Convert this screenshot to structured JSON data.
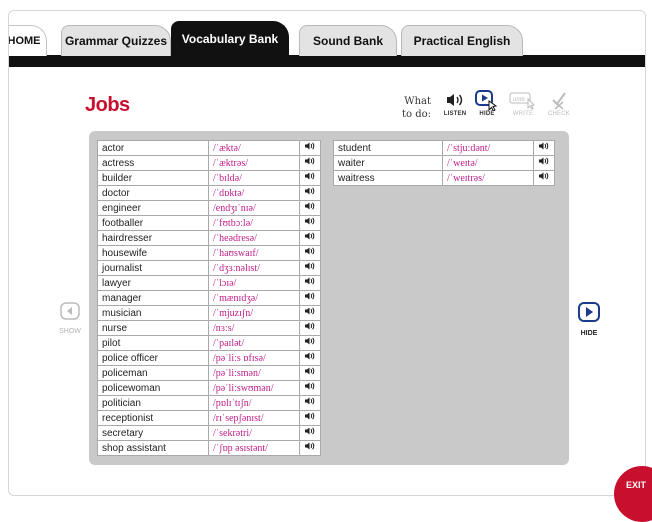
{
  "nav": {
    "tabs": [
      {
        "label": "HOME"
      },
      {
        "label": "Grammar Quizzes"
      },
      {
        "label": "Vocabulary Bank"
      },
      {
        "label": "Sound Bank"
      },
      {
        "label": "Practical English"
      }
    ],
    "active_tab": "Vocabulary Bank"
  },
  "page": {
    "title": "Jobs",
    "what_to_do_line1": "What",
    "what_to_do_line2": "to do:"
  },
  "tools": {
    "listen": {
      "label": "LISTEN",
      "icon": "speaker-icon"
    },
    "hide": {
      "label": "HIDE",
      "icon": "play-cursor-icon"
    },
    "write": {
      "label": "WRITE",
      "icon": "write-icon"
    },
    "check": {
      "label": "CHECK",
      "icon": "check-icon"
    }
  },
  "words_left": [
    {
      "word": "actor",
      "phon": "/ˈæktə/"
    },
    {
      "word": "actress",
      "phon": "/ˈæktrəs/"
    },
    {
      "word": "builder",
      "phon": "/ˈbɪldə/"
    },
    {
      "word": "doctor",
      "phon": "/ˈdɒktə/"
    },
    {
      "word": "engineer",
      "phon": "/endʒɪˈnɪə/"
    },
    {
      "word": "footballer",
      "phon": "/ˈfʊtbɔːlə/"
    },
    {
      "word": "hairdresser",
      "phon": "/ˈheədresə/"
    },
    {
      "word": "housewife",
      "phon": "/ˈhaʊswaɪf/"
    },
    {
      "word": "journalist",
      "phon": "/ˈdʒɜːnəlɪst/"
    },
    {
      "word": "lawyer",
      "phon": "/ˈlɔɪə/"
    },
    {
      "word": "manager",
      "phon": "/ˈmænɪdʒə/"
    },
    {
      "word": "musician",
      "phon": "/ˈmjuzɪʃn/"
    },
    {
      "word": "nurse",
      "phon": "/nɜːs/"
    },
    {
      "word": "pilot",
      "phon": "/ˈpaɪlət/"
    },
    {
      "word": "police officer",
      "phon": "/pəˈliːs ɒfɪsə/"
    },
    {
      "word": "policeman",
      "phon": "/pəˈliːsmən/"
    },
    {
      "word": "policewoman",
      "phon": "/pəˈliːswʊmən/"
    },
    {
      "word": "politician",
      "phon": "/pɒlɪˈtɪʃn/"
    },
    {
      "word": "receptionist",
      "phon": "/rɪˈsepʃənɪst/"
    },
    {
      "word": "secretary",
      "phon": "/ˈsekrətri/"
    },
    {
      "word": "shop assistant",
      "phon": "/ˈʃɒp əsɪstənt/"
    }
  ],
  "words_right": [
    {
      "word": "student",
      "phon": "/ˈstjuːdənt/"
    },
    {
      "word": "waiter",
      "phon": "/ˈweɪtə/"
    },
    {
      "word": "waitress",
      "phon": "/ˈweɪtrəs/"
    }
  ],
  "side": {
    "show_label": "SHOW",
    "hide_label": "HIDE"
  },
  "exit": {
    "label": "EXIT"
  },
  "colors": {
    "title": "#c8102e",
    "phonetic": "#c0208a",
    "active_tab": "#111111",
    "panel": "#c9c9c9",
    "exit": "#c8102e"
  }
}
